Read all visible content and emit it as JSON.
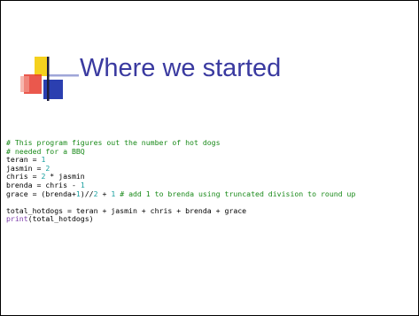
{
  "slide": {
    "title": "Where we started",
    "code": {
      "comment1": "# This program figures out the number of hot dogs",
      "comment2": "# needed for a BBQ",
      "line_teran": {
        "var": "teran = ",
        "num": "1"
      },
      "line_jasmin": {
        "var": "jasmin = ",
        "num": "2"
      },
      "line_chris": {
        "var": "chris = ",
        "num": "2",
        "rest": " * jasmin"
      },
      "line_brenda": {
        "var": "brenda = chris - ",
        "num": "1"
      },
      "line_grace": {
        "part1": "grace = (brenda+",
        "num1": "1",
        "part2": ")//",
        "num2": "2",
        "part3": " + ",
        "num3": "1",
        "comment": " # add 1 to brenda using truncated division to round up"
      },
      "line_total": "total_hotdogs = teran + jasmin + chris + brenda + grace",
      "line_print": {
        "builtin": "print",
        "args": "(total_hotdogs)"
      }
    }
  }
}
